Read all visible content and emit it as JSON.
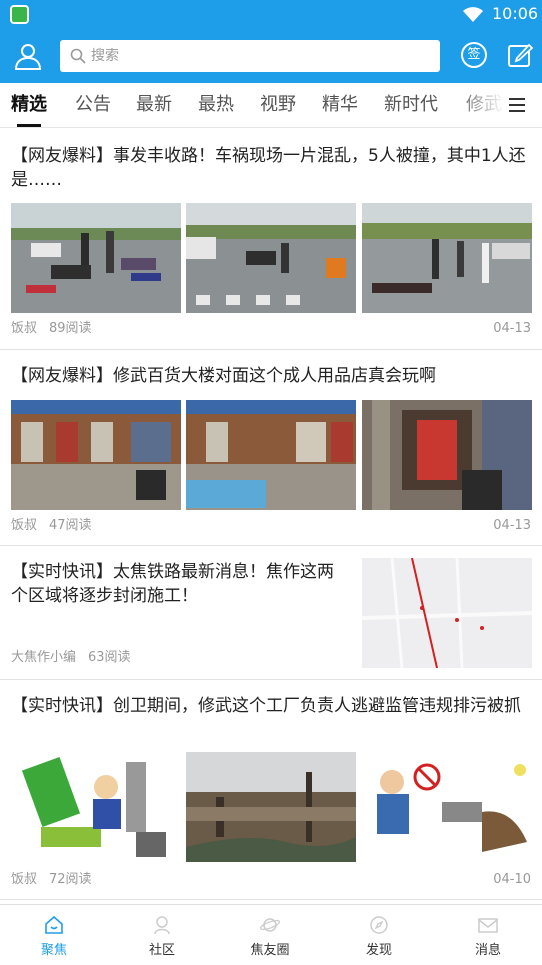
{
  "status_bar": {
    "time": "10:06"
  },
  "header": {
    "search_placeholder": "搜索",
    "sign_label": "签"
  },
  "tabs": [
    "精选",
    "公告",
    "最新",
    "最热",
    "视野",
    "精华",
    "新时代",
    "修武"
  ],
  "articles": [
    {
      "title": "【网友爆料】事发丰收路！车祸现场一片混乱，5人被撞，其中1人还是……",
      "author": "饭叔",
      "reads": "89阅读",
      "date": "04-13",
      "images": [
        "车祸现场1",
        "车祸现场2",
        "车祸现场3"
      ]
    },
    {
      "title": "【网友爆料】修武百货大楼对面这个成人用品店真会玩啊",
      "author": "饭叔",
      "reads": "47阅读",
      "date": "04-13",
      "images": [
        "街道店铺1",
        "街道店铺2",
        "成人用品店门口"
      ]
    },
    {
      "title": "【实时快讯】太焦铁路最新消息！焦作这两个区域将逐步封闭施工！",
      "author": "大焦作小编",
      "reads": "63阅读",
      "date": "",
      "images": [
        "地图"
      ]
    },
    {
      "title": "【实时快讯】创卫期间，修武这个工厂负责人逃避监管违规排污被抓",
      "author": "饭叔",
      "reads": "72阅读",
      "date": "04-10",
      "images": [
        "漫画",
        "污水河道",
        "排污漫画"
      ]
    }
  ],
  "bottom_nav": [
    {
      "label": "聚焦",
      "icon": "home-icon",
      "active": true
    },
    {
      "label": "社区",
      "icon": "community-icon",
      "active": false
    },
    {
      "label": "焦友圈",
      "icon": "planet-icon",
      "active": false
    },
    {
      "label": "发现",
      "icon": "compass-icon",
      "active": false
    },
    {
      "label": "消息",
      "icon": "mail-icon",
      "active": false
    }
  ],
  "colors": {
    "accent": "#1e9ee8",
    "text": "#222222",
    "meta": "#999999"
  }
}
